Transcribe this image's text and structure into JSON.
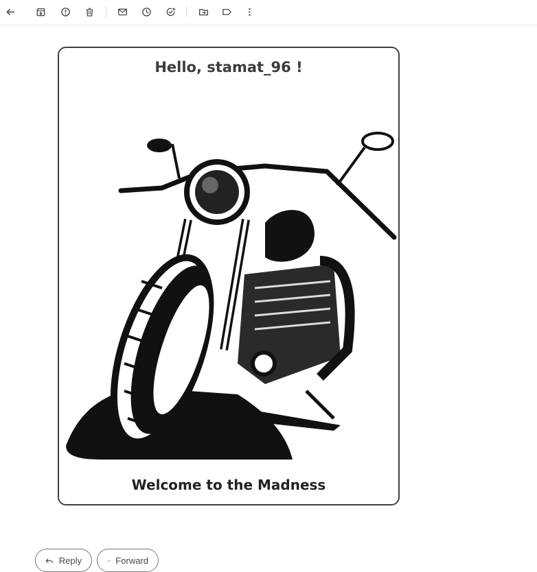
{
  "toolbar": {
    "items": [
      {
        "name": "back-icon"
      },
      {
        "name": "archive-icon"
      },
      {
        "name": "report-spam-icon"
      },
      {
        "name": "delete-icon"
      },
      {
        "name": "mark-unread-icon"
      },
      {
        "name": "snooze-icon"
      },
      {
        "name": "add-to-tasks-icon"
      },
      {
        "name": "move-to-icon"
      },
      {
        "name": "label-icon"
      },
      {
        "name": "more-options-icon"
      }
    ]
  },
  "email": {
    "greeting": "Hello, stamat_96 !",
    "image": "motorcycle-illustration",
    "welcome": "Welcome to the Madness"
  },
  "actions": {
    "reply_label": "Reply",
    "forward_label": "Forward"
  }
}
